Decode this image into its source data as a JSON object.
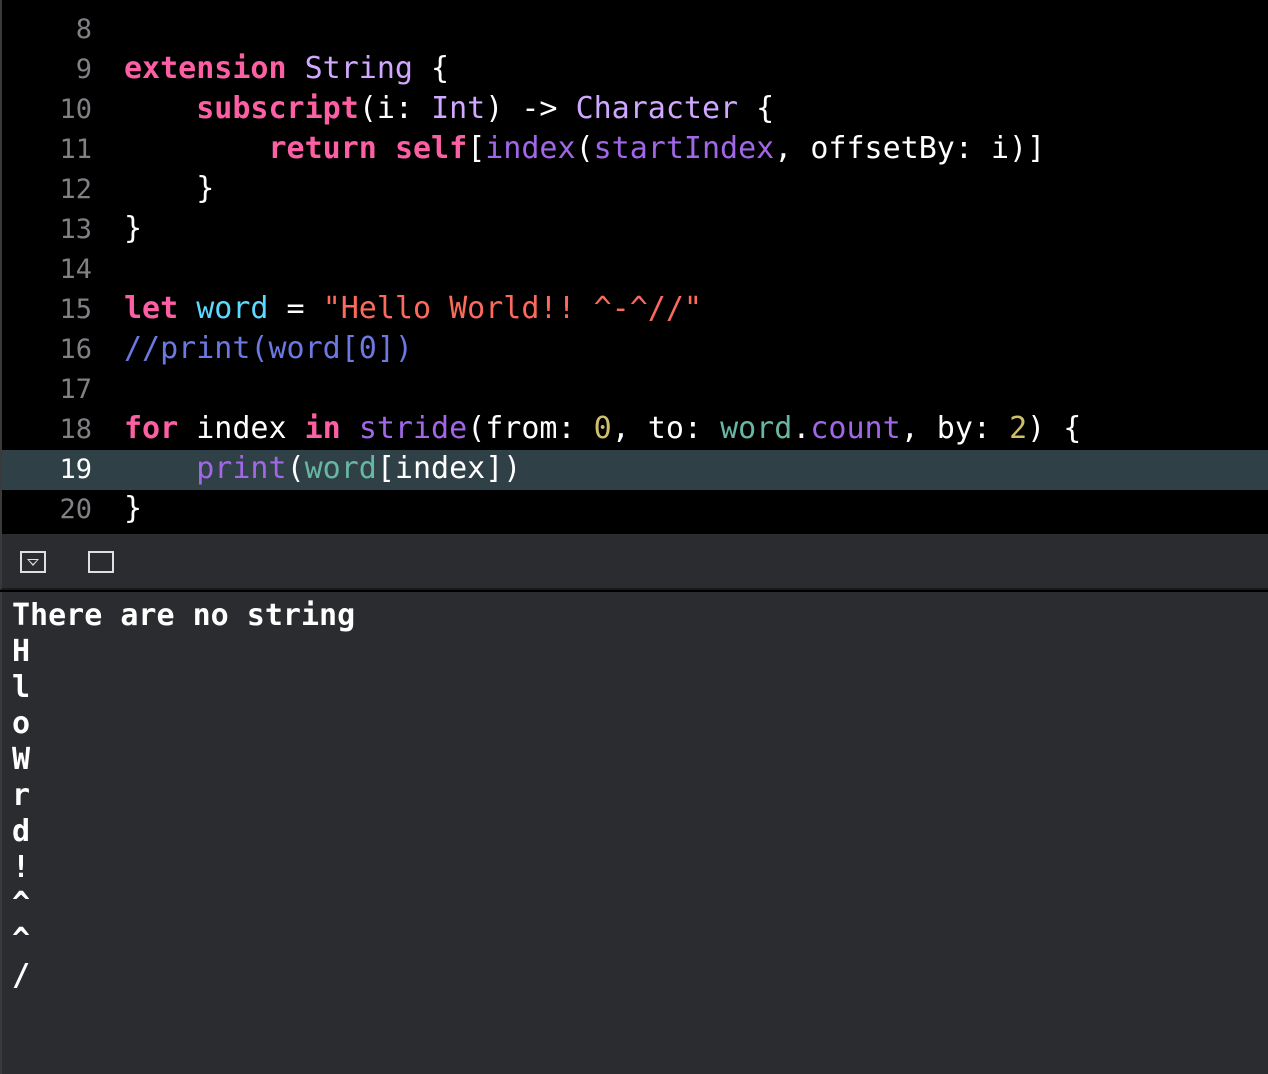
{
  "editor": {
    "current_line": "19",
    "lines": [
      {
        "num": "8",
        "tokens": []
      },
      {
        "num": "9",
        "tokens": [
          [
            "kw",
            "extension"
          ],
          [
            "pl",
            " "
          ],
          [
            "ty",
            "String"
          ],
          [
            "pl",
            " {"
          ]
        ]
      },
      {
        "num": "10",
        "tokens": [
          [
            "pl",
            "    "
          ],
          [
            "kw",
            "subscript"
          ],
          [
            "pl",
            "(i: "
          ],
          [
            "ty",
            "Int"
          ],
          [
            "pl",
            ") -> "
          ],
          [
            "ty",
            "Character"
          ],
          [
            "pl",
            " {"
          ]
        ]
      },
      {
        "num": "11",
        "tokens": [
          [
            "pl",
            "        "
          ],
          [
            "kw",
            "return"
          ],
          [
            "pl",
            " "
          ],
          [
            "kw",
            "self"
          ],
          [
            "pl",
            "["
          ],
          [
            "fn",
            "index"
          ],
          [
            "pl",
            "("
          ],
          [
            "mem",
            "startIndex"
          ],
          [
            "pl",
            ", offsetBy: i)]"
          ]
        ]
      },
      {
        "num": "12",
        "tokens": [
          [
            "pl",
            "    }"
          ]
        ]
      },
      {
        "num": "13",
        "tokens": [
          [
            "pl",
            "}"
          ]
        ]
      },
      {
        "num": "14",
        "tokens": []
      },
      {
        "num": "15",
        "tokens": [
          [
            "kw",
            "let"
          ],
          [
            "pl",
            " "
          ],
          [
            "decl",
            "word"
          ],
          [
            "pl",
            " = "
          ],
          [
            "str",
            "\"Hello World!! ^-^//\""
          ]
        ]
      },
      {
        "num": "16",
        "tokens": [
          [
            "cmt",
            "//print(word[0])"
          ]
        ]
      },
      {
        "num": "17",
        "tokens": []
      },
      {
        "num": "18",
        "tokens": [
          [
            "kw",
            "for"
          ],
          [
            "pl",
            " index "
          ],
          [
            "kw",
            "in"
          ],
          [
            "pl",
            " "
          ],
          [
            "fn",
            "stride"
          ],
          [
            "pl",
            "(from: "
          ],
          [
            "num",
            "0"
          ],
          [
            "pl",
            ", to: "
          ],
          [
            "var",
            "word"
          ],
          [
            "pl",
            "."
          ],
          [
            "mem",
            "count"
          ],
          [
            "pl",
            ", by: "
          ],
          [
            "num",
            "2"
          ],
          [
            "pl",
            ") {"
          ]
        ]
      },
      {
        "num": "19",
        "tokens": [
          [
            "pl",
            "    "
          ],
          [
            "fn",
            "print"
          ],
          [
            "pl",
            "("
          ],
          [
            "var",
            "word"
          ],
          [
            "pl",
            "[index])"
          ]
        ]
      },
      {
        "num": "20",
        "tokens": [
          [
            "pl",
            "}"
          ]
        ]
      }
    ]
  },
  "debug_bar": {
    "hide_icon": "hide-debug-area-icon",
    "split_icon": "split-view-icon"
  },
  "console": {
    "lines": [
      "There are no string",
      "H",
      "l",
      "o",
      "W",
      "r",
      "d",
      "!",
      "^",
      "^",
      "/"
    ]
  }
}
